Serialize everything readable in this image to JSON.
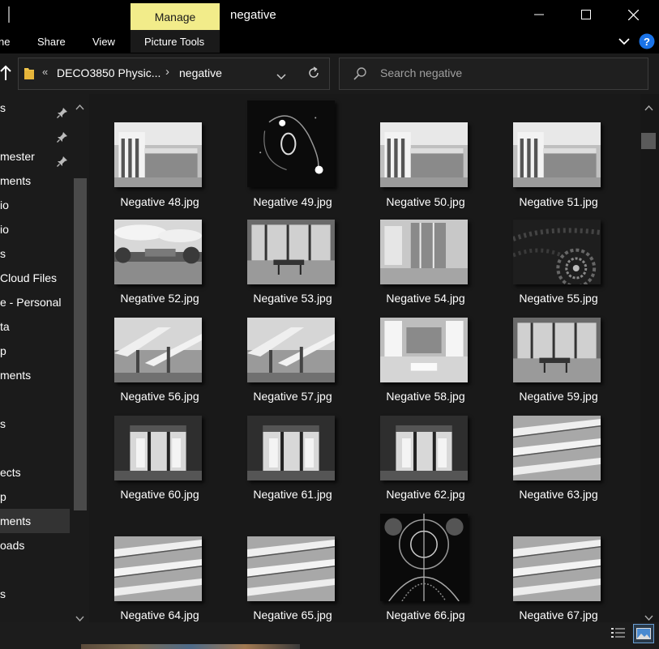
{
  "titlebar": {
    "manage_label": "Manage",
    "window_title": "negative",
    "minimize_icon": "minimize-icon",
    "maximize_icon": "maximize-icon",
    "close_icon": "close-icon"
  },
  "ribbon": {
    "tabs": [
      "ne",
      "Share",
      "View",
      "Picture Tools"
    ],
    "expand_icon": "chevron-down-icon",
    "help_icon": "help-icon"
  },
  "address": {
    "up_icon": "up-arrow-icon",
    "folder_icon": "folder-icon",
    "overflow": "«",
    "crumb_parent": "DECO3850 Physic...",
    "crumb_separator": "›",
    "crumb_current": "negative",
    "history_icon": "chevron-down-icon",
    "refresh_icon": "refresh-icon"
  },
  "search": {
    "placeholder": "Search negative",
    "icon": "search-icon"
  },
  "nav": {
    "items": [
      {
        "label": "s",
        "pinned": true
      },
      {
        "label": "",
        "pinned": true
      },
      {
        "label": "mester",
        "pinned": true
      },
      {
        "label": "ments",
        "pinned": false
      },
      {
        "label": "io",
        "pinned": false
      },
      {
        "label": "io",
        "pinned": false
      },
      {
        "label": "s",
        "pinned": false
      },
      {
        "label": "Cloud Files",
        "pinned": false
      },
      {
        "label": "e - Personal",
        "pinned": false
      },
      {
        "label": "ta",
        "pinned": false
      },
      {
        "label": "p",
        "pinned": false
      },
      {
        "label": "ments",
        "pinned": false
      },
      {
        "label": "",
        "pinned": false
      },
      {
        "label": "s",
        "pinned": false
      },
      {
        "label": "",
        "pinned": false
      },
      {
        "label": "ects",
        "pinned": false
      },
      {
        "label": "p",
        "pinned": false
      },
      {
        "label": "ments",
        "pinned": false,
        "selected": true
      },
      {
        "label": "oads",
        "pinned": false
      },
      {
        "label": "",
        "pinned": false
      },
      {
        "label": "s",
        "pinned": false
      }
    ]
  },
  "files": [
    {
      "name": "Negative 48.jpg",
      "kind": "building-white"
    },
    {
      "name": "Negative 49.jpg",
      "kind": "nebula"
    },
    {
      "name": "Negative 50.jpg",
      "kind": "building-white"
    },
    {
      "name": "Negative 51.jpg",
      "kind": "building-white"
    },
    {
      "name": "Negative 52.jpg",
      "kind": "sky-landscape"
    },
    {
      "name": "Negative 53.jpg",
      "kind": "lobby"
    },
    {
      "name": "Negative 54.jpg",
      "kind": "glass-hall"
    },
    {
      "name": "Negative 55.jpg",
      "kind": "fractal-dark"
    },
    {
      "name": "Negative 56.jpg",
      "kind": "atrium-stairs"
    },
    {
      "name": "Negative 57.jpg",
      "kind": "atrium-stairs"
    },
    {
      "name": "Negative 58.jpg",
      "kind": "bright-hall"
    },
    {
      "name": "Negative 59.jpg",
      "kind": "lobby"
    },
    {
      "name": "Negative 60.jpg",
      "kind": "doors"
    },
    {
      "name": "Negative 61.jpg",
      "kind": "doors"
    },
    {
      "name": "Negative 62.jpg",
      "kind": "doors"
    },
    {
      "name": "Negative 63.jpg",
      "kind": "balconies"
    },
    {
      "name": "Negative 64.jpg",
      "kind": "balconies"
    },
    {
      "name": "Negative 65.jpg",
      "kind": "balconies"
    },
    {
      "name": "Negative 66.jpg",
      "kind": "fractal-symmetric"
    },
    {
      "name": "Negative 67.jpg",
      "kind": "balconies"
    }
  ],
  "statusbar": {
    "details_view_icon": "details-view-icon",
    "thumbnail_view_icon": "large-icons-view-icon"
  }
}
